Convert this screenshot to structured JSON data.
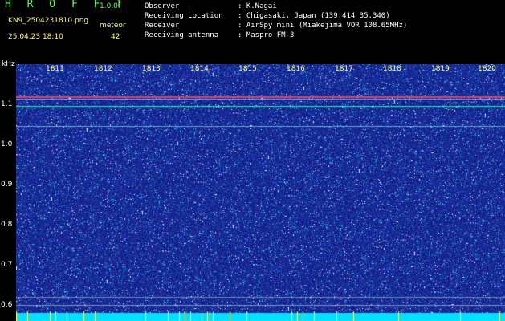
{
  "header": {
    "app_title": "H R O F F T",
    "version": "1.0.0f",
    "file_name": "KN9_2504231810.png",
    "meteor_label": "meteor",
    "timestamp": "25.04.23 18:10",
    "meteor_count": "42"
  },
  "info": {
    "observer_label": "Observer",
    "observer_value": ": K.Nagai",
    "location_label": "Receiving Location",
    "location_value": ": Chigasaki, Japan (139.414 35.340)",
    "receiver_label": "Receiver",
    "receiver_value": ": AirSpy mini (Miakejima VOR 108.65MHz)",
    "antenna_label": "Receiving antenna",
    "antenna_value": ": Maspro FM-3"
  },
  "y_axis": {
    "unit": "kHz",
    "ticks": [
      "1.1",
      "1.0",
      "0.9",
      "0.8",
      "0.7",
      "0.6"
    ]
  },
  "x_axis": {
    "ticks": [
      "1811",
      "1812",
      "1813",
      "1814",
      "1815",
      "1816",
      "1817",
      "1818",
      "1819",
      "1820"
    ]
  },
  "colors": {
    "background": "#000000",
    "noise_base": "#1c2c9c",
    "title_green": "#5cff5c",
    "label_yellow": "#ffff66",
    "bottom_band": "#00e0ff"
  }
}
